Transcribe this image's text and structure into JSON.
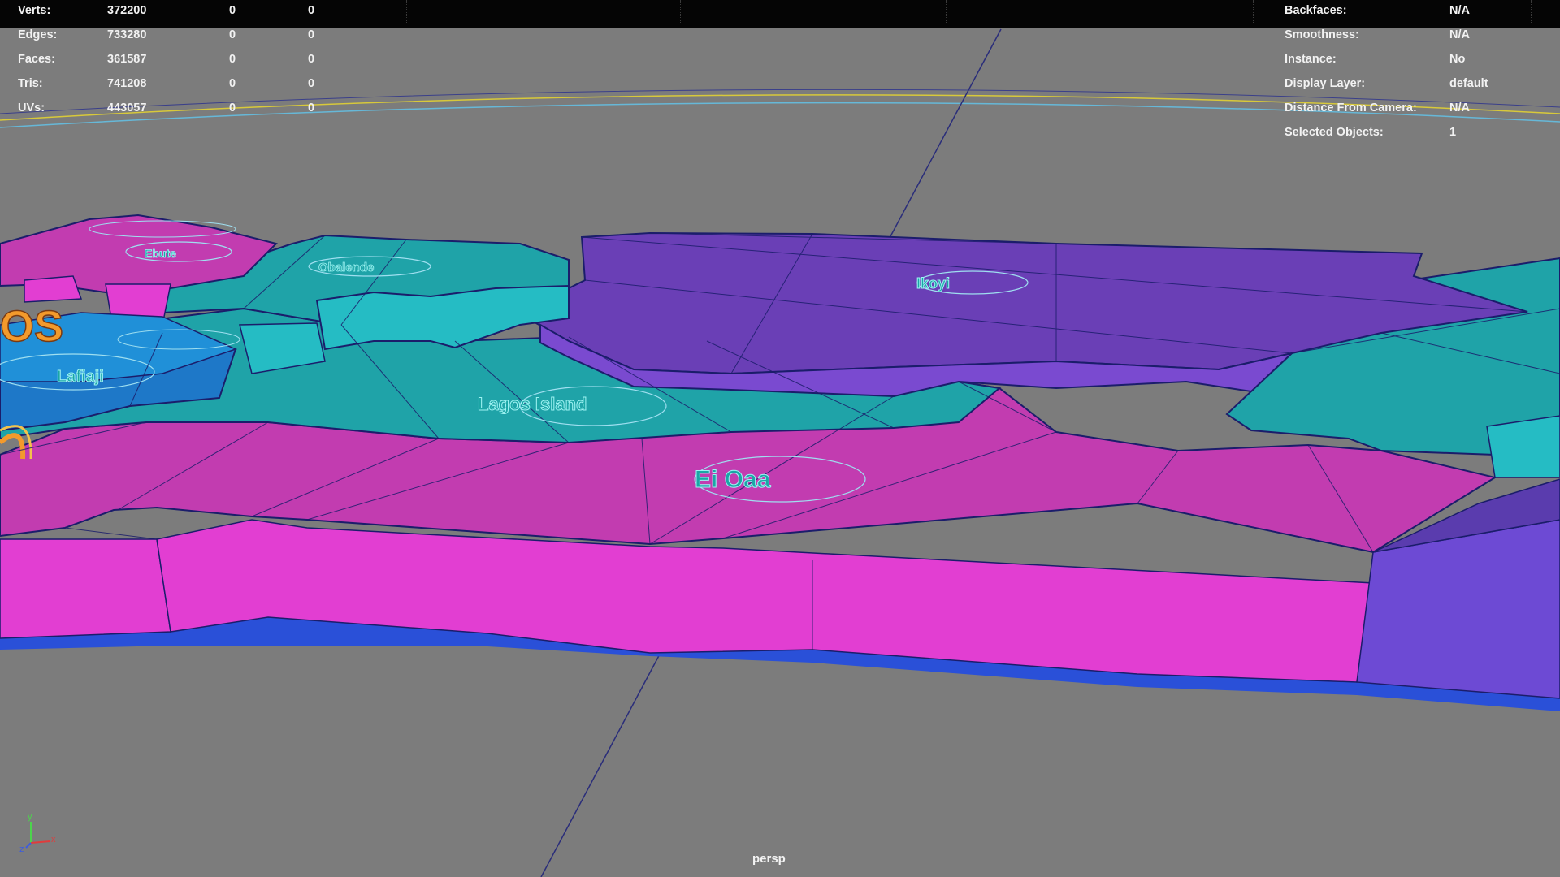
{
  "viewport": {
    "camera": "persp",
    "background_color": "#7c7c7c",
    "heads_up_display": {
      "poly_count": [
        {
          "label": "Verts:",
          "values": [
            "372200",
            "0",
            "0"
          ]
        },
        {
          "label": "Edges:",
          "values": [
            "733280",
            "0",
            "0"
          ]
        },
        {
          "label": "Faces:",
          "values": [
            "361587",
            "0",
            "0"
          ]
        },
        {
          "label": "Tris:",
          "values": [
            "741208",
            "0",
            "0"
          ]
        },
        {
          "label": "UVs:",
          "values": [
            "443057",
            "0",
            "0"
          ]
        }
      ],
      "object_details": [
        {
          "label": "Backfaces:",
          "value": "N/A"
        },
        {
          "label": "Smoothness:",
          "value": "N/A"
        },
        {
          "label": "Instance:",
          "value": "No"
        },
        {
          "label": "Display Layer:",
          "value": "default"
        },
        {
          "label": "Distance From Camera:",
          "value": "N/A"
        },
        {
          "label": "Selected Objects:",
          "value": "1"
        }
      ]
    },
    "axis_gizmo": {
      "x": "x",
      "y": "y",
      "z": "z"
    },
    "model_colors": {
      "magenta": "#c23cb0",
      "magenta_side": "#e23ed2",
      "teal": "#1fa3a8",
      "teal_side": "#25bcc4",
      "purple": "#6a3fb6",
      "purple_side": "#7a4ad0",
      "wireframe": "#1b1d6b"
    }
  }
}
